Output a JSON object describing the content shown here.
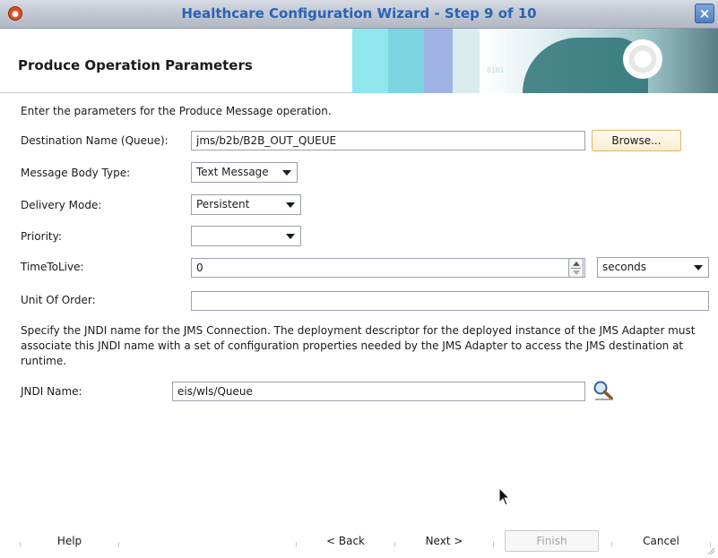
{
  "window": {
    "title": "Healthcare Configuration Wizard - Step 9 of 10",
    "close_glyph": "×"
  },
  "header": {
    "title": "Produce Operation Parameters",
    "art_bits": "0101"
  },
  "intro": "Enter the parameters for the Produce Message operation.",
  "form": {
    "destination": {
      "label": "Destination Name (Queue):",
      "value": "jms/b2b/B2B_OUT_QUEUE",
      "browse_label": "Browse..."
    },
    "message_body_type": {
      "label": "Message Body Type:",
      "value": "Text Message"
    },
    "delivery_mode": {
      "label": "Delivery Mode:",
      "value": "Persistent"
    },
    "priority": {
      "label": "Priority:",
      "value": ""
    },
    "time_to_live": {
      "label": "TimeToLive:",
      "value": "0",
      "unit": "seconds"
    },
    "unit_of_order": {
      "label": "Unit Of Order:",
      "value": ""
    }
  },
  "jndi_description": "Specify the JNDI name for the JMS Connection.  The deployment descriptor for the deployed instance of the JMS Adapter must associate this JNDI name with a set of configuration properties needed by the JMS Adapter to access the JMS destination at runtime.",
  "jndi": {
    "label": "JNDI Name:",
    "value": "eis/wls/Queue"
  },
  "footer": {
    "help": "Help",
    "back": "< Back",
    "next": "Next >",
    "finish": "Finish",
    "cancel": "Cancel"
  },
  "icons": {
    "app": "oracle-logo-icon",
    "close": "close-icon",
    "search": "search-icon",
    "cursor": "mouse-pointer-icon"
  }
}
